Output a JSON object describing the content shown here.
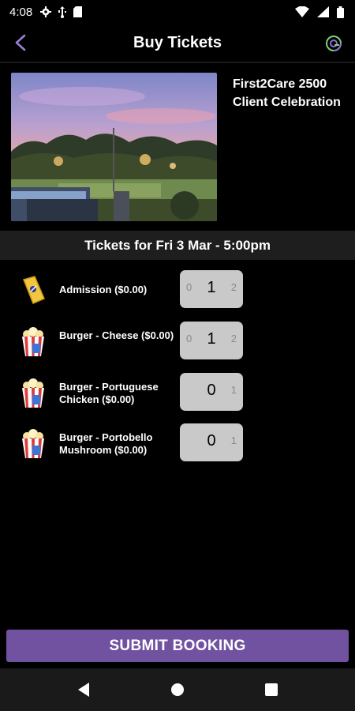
{
  "status": {
    "time": "4:08"
  },
  "header": {
    "title": "Buy Tickets",
    "back_icon": "back-arrow-icon",
    "app_icon": "app-logo-icon"
  },
  "event": {
    "title": "First2Care 2500 Client Celebration"
  },
  "session": {
    "label": "Tickets for Fri 3 Mar - 5:00pm"
  },
  "tickets": [
    {
      "name": "Admission ($0.00)",
      "icon": "ticket-icon",
      "prev": "0",
      "value": "1",
      "next": "2"
    },
    {
      "name": "Burger - Cheese ($0.00)",
      "icon": "popcorn-icon",
      "prev": "0",
      "value": "1",
      "next": "2"
    },
    {
      "name": "Burger - Portuguese Chicken ($0.00)",
      "icon": "popcorn-icon",
      "prev": "",
      "value": "0",
      "next": "1"
    },
    {
      "name": "Burger - Portobello Mushroom ($0.00)",
      "icon": "popcorn-icon",
      "prev": "",
      "value": "0",
      "next": "1"
    }
  ],
  "submit": {
    "label": "SUBMIT BOOKING"
  },
  "colors": {
    "accent": "#7152a0",
    "back_arrow": "#9b7fd1",
    "stepper_bg": "#c9c9c9"
  }
}
